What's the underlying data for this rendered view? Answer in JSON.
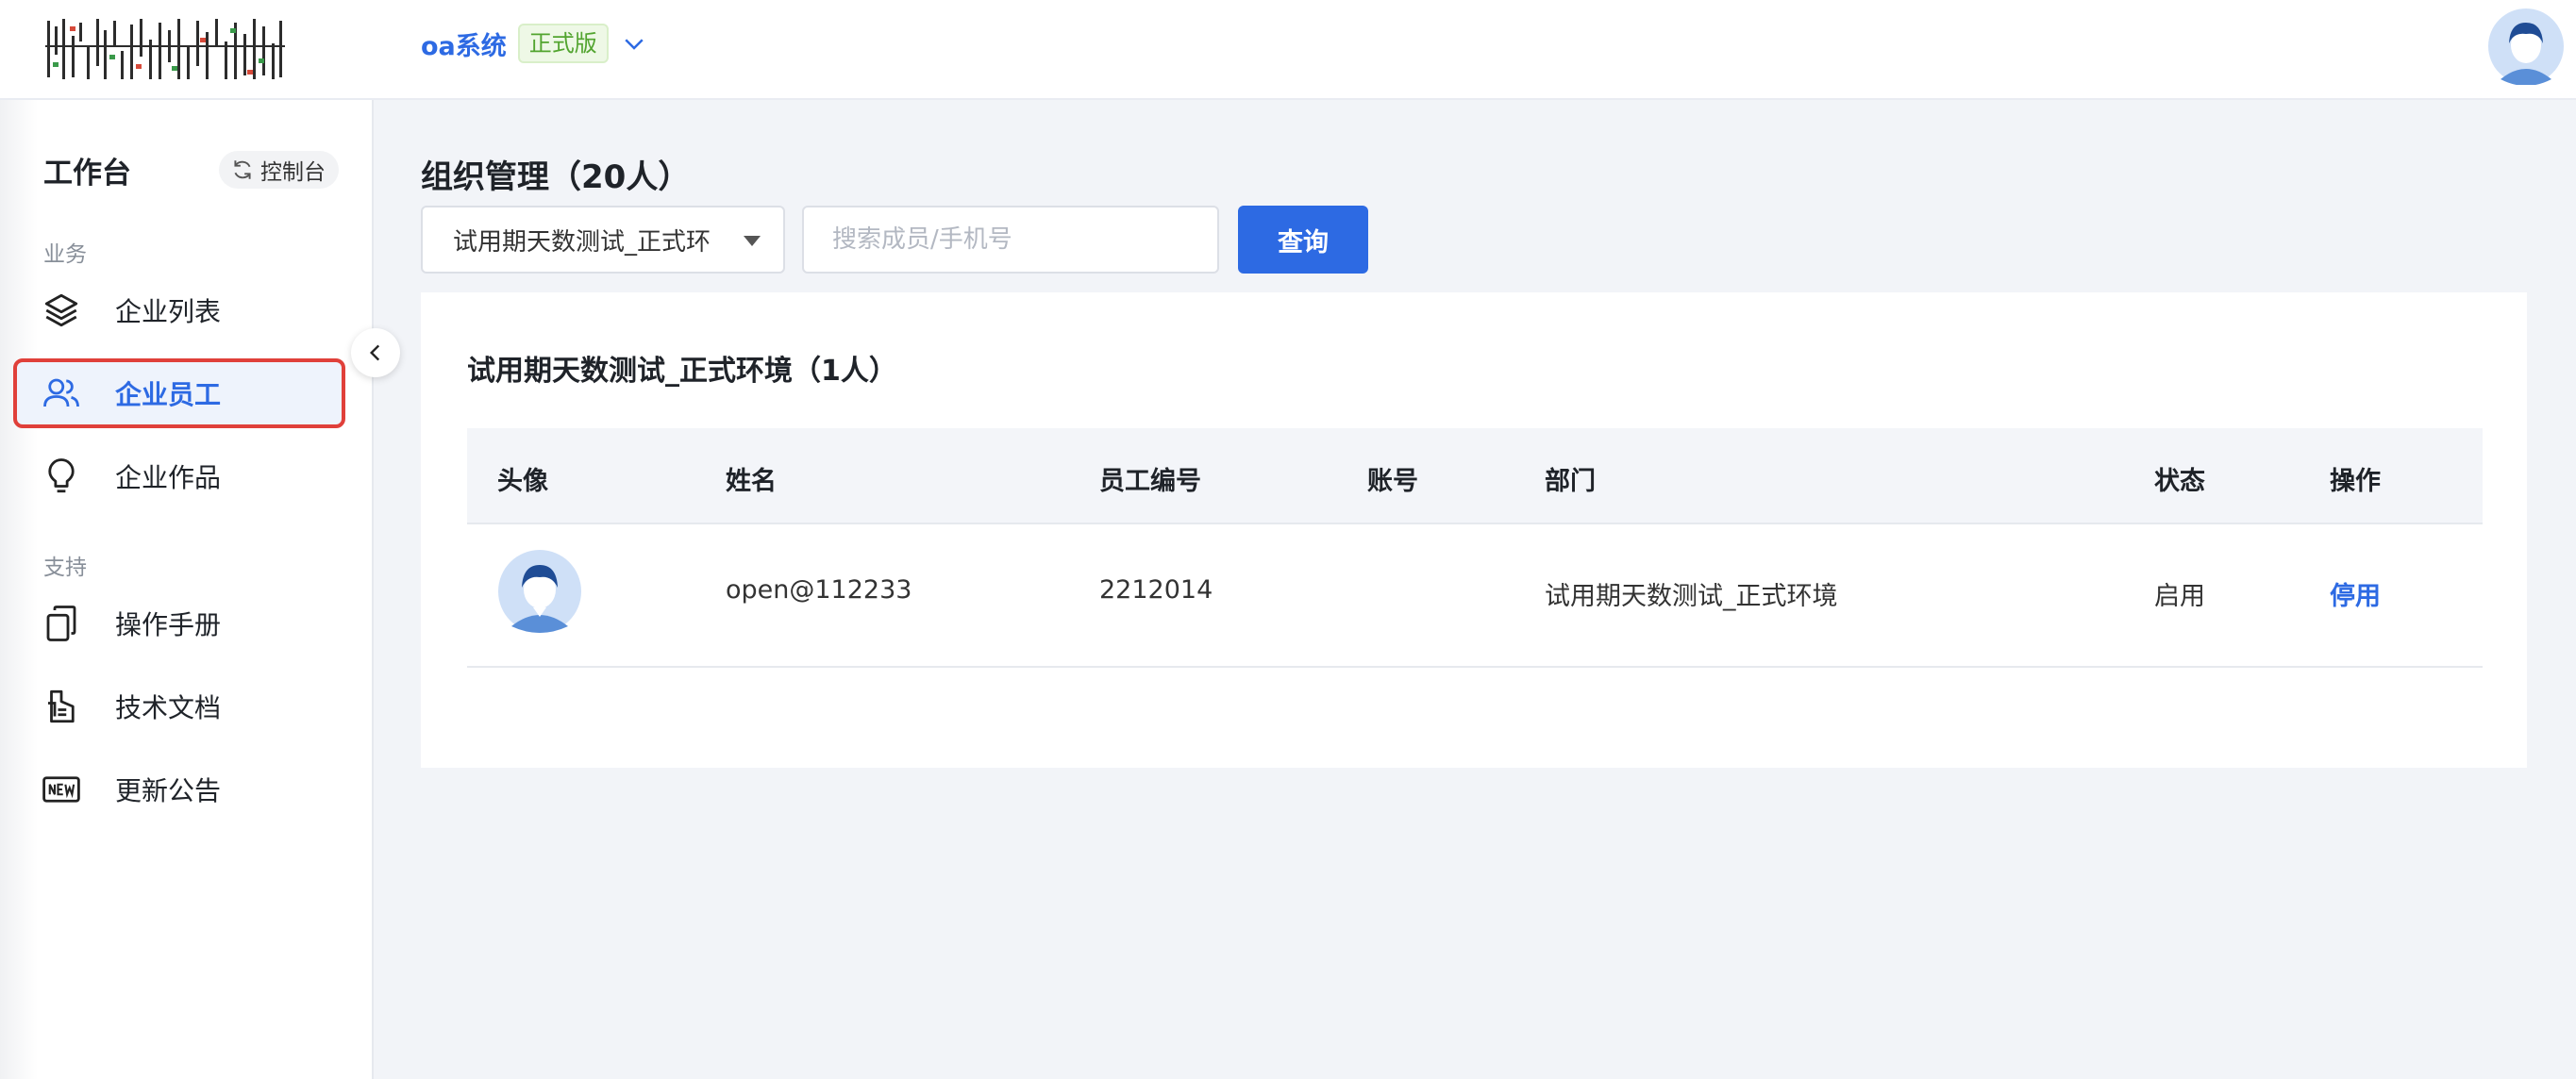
{
  "header": {
    "app_name": "oa系统",
    "edition_badge": "正式版"
  },
  "sidebar": {
    "title": "工作台",
    "console_label": "控制台",
    "groups": [
      {
        "label": "业务",
        "items": [
          {
            "label": "企业列表",
            "icon": "layers-icon"
          },
          {
            "label": "企业员工",
            "icon": "users-icon",
            "active": true
          },
          {
            "label": "企业作品",
            "icon": "lightbulb-icon"
          }
        ]
      },
      {
        "label": "支持",
        "items": [
          {
            "label": "操作手册",
            "icon": "copy-docs-icon"
          },
          {
            "label": "技术文档",
            "icon": "document-icon"
          },
          {
            "label": "更新公告",
            "icon": "new-badge-icon"
          }
        ]
      }
    ]
  },
  "main": {
    "title": "组织管理（20人）",
    "filter": {
      "selected": "试用期天数测试_正式环",
      "search_placeholder": "搜索成员/手机号",
      "query_label": "查询"
    },
    "card": {
      "title": "试用期天数测试_正式环境（1人）",
      "columns": [
        "头像",
        "姓名",
        "员工编号",
        "账号",
        "部门",
        "状态",
        "操作"
      ],
      "rows": [
        {
          "name": "open@112233",
          "employee_no": "2212014",
          "account": "",
          "department": "试用期天数测试_正式环境",
          "status": "启用",
          "action": "停用"
        }
      ]
    }
  },
  "colors": {
    "accent": "#2d6ae3",
    "badge_green": "#52a42f",
    "highlight_red": "#e0403a"
  }
}
